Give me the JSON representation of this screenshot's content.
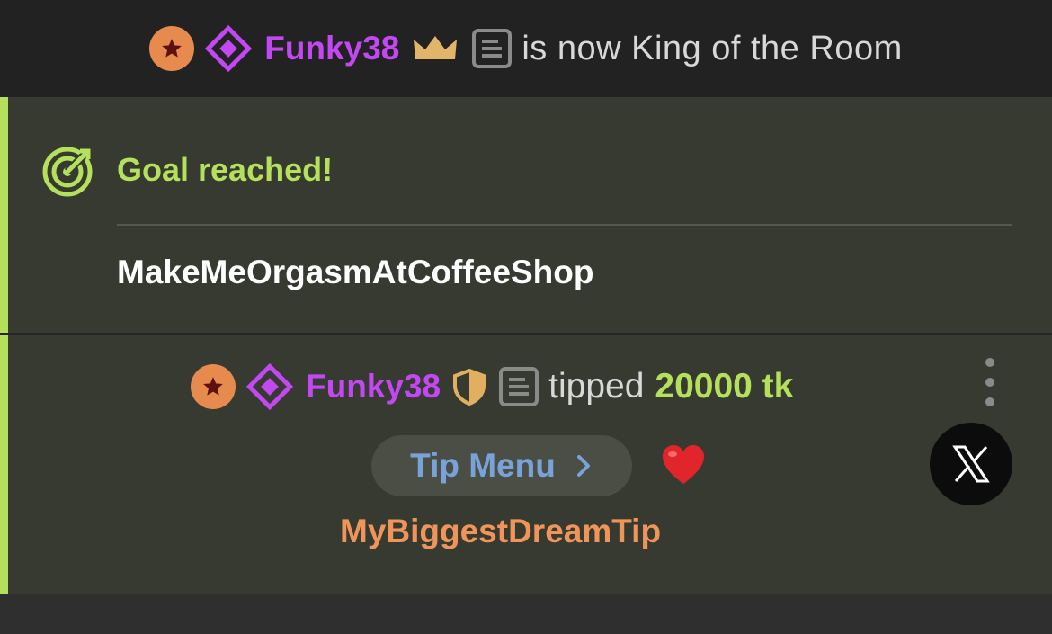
{
  "king_banner": {
    "username": "Funky38",
    "message": "is now King of the Room",
    "icons": [
      "star-badge-icon",
      "diamond-icon",
      "crown-icon",
      "document-icon"
    ],
    "username_color": "#c347f2"
  },
  "goal": {
    "title": "Goal reached!",
    "name": "MakeMeOrgasmAtCoffeeShop",
    "accent_color": "#b5e05b",
    "icon": "target-icon"
  },
  "tip": {
    "username": "Funky38",
    "verb": "tipped",
    "amount": "20000 tk",
    "icons": [
      "star-badge-icon",
      "diamond-icon",
      "shield-icon",
      "document-icon"
    ],
    "menu_button_label": "Tip Menu",
    "reaction": "heart-icon",
    "tip_item": "MyBiggestDreamTip",
    "tip_item_color": "#f0955a"
  },
  "controls": {
    "more_options": "more-options-icon",
    "close_x": "x-logo-icon"
  },
  "colors": {
    "badge_orange": "#e78a4e",
    "badge_star": "#5c1010",
    "diamond": "#c347f2",
    "crown": "#e2b66a",
    "shield": "#e0b060"
  }
}
